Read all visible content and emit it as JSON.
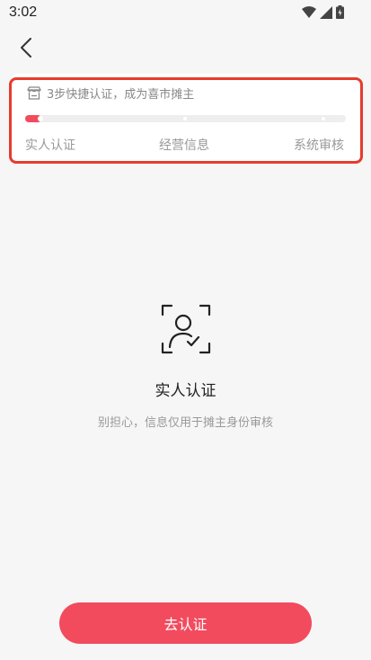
{
  "status_bar": {
    "time": "3:02"
  },
  "progress_card": {
    "header": "3步快捷认证，成为喜市摊主",
    "progress": 0.05,
    "steps": [
      "实人认证",
      "经营信息",
      "系统审核"
    ],
    "accent": "#f24b5e",
    "outline": "#e63b2e"
  },
  "main": {
    "title": "实人认证",
    "subtitle": "别担心，信息仅用于摊主身份审核"
  },
  "cta": {
    "label": "去认证"
  }
}
